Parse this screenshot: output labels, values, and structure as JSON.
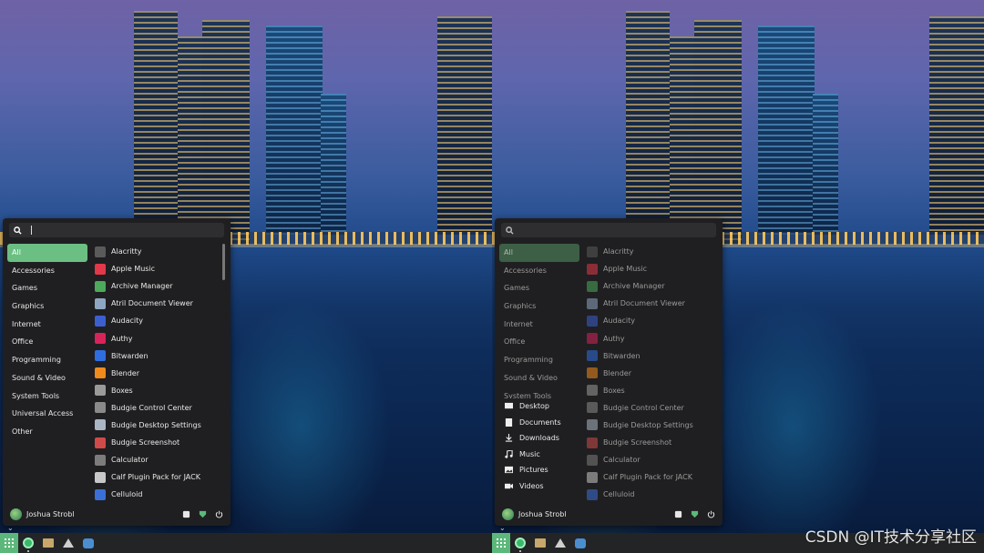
{
  "search": {
    "placeholder": ""
  },
  "categories": [
    "All",
    "Accessories",
    "Games",
    "Graphics",
    "Internet",
    "Office",
    "Programming",
    "Sound & Video",
    "System Tools",
    "Universal Access",
    "Other"
  ],
  "apps": [
    {
      "label": "Alacritty",
      "icon": "alacritty-icon",
      "color": "#5a5a5a"
    },
    {
      "label": "Apple Music",
      "icon": "apple-music-icon",
      "color": "#e2384a"
    },
    {
      "label": "Archive Manager",
      "icon": "archive-manager-icon",
      "color": "#4caa5a"
    },
    {
      "label": "Atril Document Viewer",
      "icon": "atril-icon",
      "color": "#8fa6c2"
    },
    {
      "label": "Audacity",
      "icon": "audacity-icon",
      "color": "#3c5fcf"
    },
    {
      "label": "Authy",
      "icon": "authy-icon",
      "color": "#d8235b"
    },
    {
      "label": "Bitwarden",
      "icon": "bitwarden-icon",
      "color": "#2f6ee0"
    },
    {
      "label": "Blender",
      "icon": "blender-icon",
      "color": "#f08a1d"
    },
    {
      "label": "Boxes",
      "icon": "boxes-icon",
      "color": "#9a9a9a"
    },
    {
      "label": "Budgie Control Center",
      "icon": "budgie-control-center-icon",
      "color": "#8a8a8a"
    },
    {
      "label": "Budgie Desktop Settings",
      "icon": "budgie-desktop-settings-icon",
      "color": "#aab6c4"
    },
    {
      "label": "Budgie Screenshot",
      "icon": "budgie-screenshot-icon",
      "color": "#d04a4a"
    },
    {
      "label": "Calculator",
      "icon": "calculator-icon",
      "color": "#7c7c7c"
    },
    {
      "label": "Calf Plugin Pack for JACK",
      "icon": "calf-icon",
      "color": "#c8c8c8"
    },
    {
      "label": "Celluloid",
      "icon": "celluloid-icon",
      "color": "#3a6fd8"
    }
  ],
  "places": [
    {
      "label": "Desktop",
      "icon": "desktop-icon"
    },
    {
      "label": "Documents",
      "icon": "documents-icon"
    },
    {
      "label": "Downloads",
      "icon": "downloads-icon"
    },
    {
      "label": "Music",
      "icon": "music-icon"
    },
    {
      "label": "Pictures",
      "icon": "pictures-icon"
    },
    {
      "label": "Videos",
      "icon": "videos-icon"
    }
  ],
  "user": {
    "name": "Joshua Strobl"
  },
  "panel": {
    "apps": [
      "app-menu-icon",
      "budgie-icon",
      "files-icon",
      "inkscape-icon",
      "godot-icon"
    ]
  },
  "watermark": "CSDN @IT技术分享社区",
  "colors": {
    "accent": "#5cb87a",
    "menu_bg": "#1f1f21",
    "panel_bg": "#232426"
  }
}
